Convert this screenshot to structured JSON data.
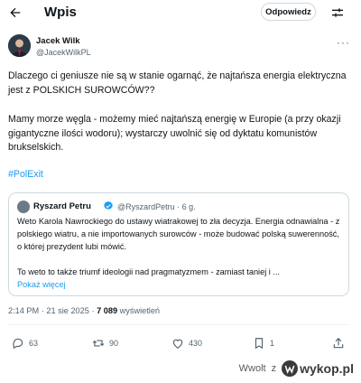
{
  "header": {
    "title": "Wpis",
    "reply_label": "Odpowiedz"
  },
  "author": {
    "name": "Jacek Wilk",
    "handle": "@JacekWilkPL"
  },
  "tweet": {
    "paragraph1": "Dlaczego ci geniusze nie są w stanie ogarnąć, że najtańsza energia elektryczna jest z POLSKICH SUROWCÓW??",
    "paragraph2": "Mamy morze węgla - możemy mieć najtańszą energię w Europie (a przy okazji gigantyczne ilości wodoru); wystarczy uwolnić się od dyktatu komunistów brukselskich.",
    "hashtag": "#PolExit"
  },
  "quote": {
    "name": "Ryszard Petru",
    "handle_time": "@RyszardPetru · 6 g.",
    "text1": "Weto Karola Nawrockiego do ustawy wiatrakowej to zła decyzja. Energia odnawialna - z polskiego wiatru, a nie importowanych surowców - może budować polską suwerenność, o której prezydent lubi mówić.",
    "text2": "To weto to także triumf ideologii nad pragmatyzmem - zamiast taniej i ...",
    "show_more": "Pokaż więcej"
  },
  "meta": {
    "time": "2:14 PM · 21 sie 2025 · ",
    "views": "7 089",
    "views_label": " wyświetleń"
  },
  "actions": {
    "replies": "63",
    "reposts": "90",
    "likes": "430",
    "bookmarks": "1"
  },
  "watermark": {
    "user": "Wwolt",
    "z": "z",
    "site": "wykop.pl"
  },
  "colors": {
    "link": "#1d9bf0",
    "muted": "#536471",
    "text": "#0f1419",
    "border": "#cfd9de"
  },
  "icons": [
    "back-arrow-icon",
    "filter-icon",
    "more-icon",
    "verified-icon",
    "reply-icon",
    "repost-icon",
    "like-icon",
    "bookmark-icon",
    "share-icon",
    "wykop-logo-icon"
  ]
}
